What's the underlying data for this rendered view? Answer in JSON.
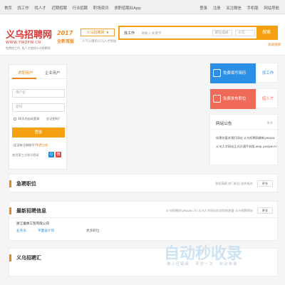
{
  "topbar": {
    "left_links": [
      "首页",
      "找工作",
      "找人才",
      "近期招聘",
      "行业招聘",
      "职场资讯",
      "求职招聘业App"
    ],
    "right_links": [
      "登录",
      "注册",
      "关注微信",
      "手机版",
      "网站导航"
    ]
  },
  "header": {
    "logo_cn": "义乌招聘网",
    "logo_domain": "WWW.YWZPW.CN",
    "logo_slogan": "免费找工作, 找人才就到义乌招聘网",
    "year": "2017",
    "year_sub": "全新首版",
    "city_button": "义乌招聘网",
    "city_hint": "人气火爆的义乌人才网站"
  },
  "search": {
    "type_label": "找工作",
    "placeholder": "请输入关键字",
    "select1": "职位选择",
    "select2": "义乌",
    "button": "搜索",
    "advanced": "高级搜索"
  },
  "login": {
    "tab_personal": "求职用户",
    "tab_company": "企业用户",
    "username_placeholder": "用户名",
    "password_placeholder": "密码",
    "remember": "30天内自动登录",
    "forgot": "忘记密码?",
    "button": "登录",
    "register_prefix": "还没有注册账号?",
    "register_link": "免费注册",
    "other_login": "使用第三方账号登录",
    "qq": "Q",
    "weibo": "微"
  },
  "cta": {
    "resume_text": "免费填写简历",
    "resume_action": "找工作",
    "job_text": "免费发布职位",
    "job_action": "招人才"
  },
  "notice": {
    "title": "网站公告",
    "more": "更多",
    "items": [
      "如果你喜欢我们网站 义乌招聘网最新ywzpw",
      "义乌人才网站正式开通手机版,wap.ywzpw.cn"
    ]
  },
  "sections": {
    "urgent": {
      "title": "急聘职位",
      "right_text": "急招高薪,热门职位,抢先报名",
      "more": "更多"
    },
    "latest": {
      "title": "最新招聘信息",
      "right_text": "义乌招聘网(ywzpw.cn) 义乌人才网站欢迎您的加盟 义乌招聘网站",
      "more": "更多",
      "company": "浙江童帅工贸有限公司",
      "jobs": [
        "业务员",
        "平面设计师"
      ],
      "more_jobs": "更多职位"
    },
    "collection": {
      "title": "义乌招聘汇"
    }
  },
  "watermark": {
    "brand": "自动秒收录",
    "slogan": "做上佳链接 · 来访一次 · 自动收录"
  }
}
